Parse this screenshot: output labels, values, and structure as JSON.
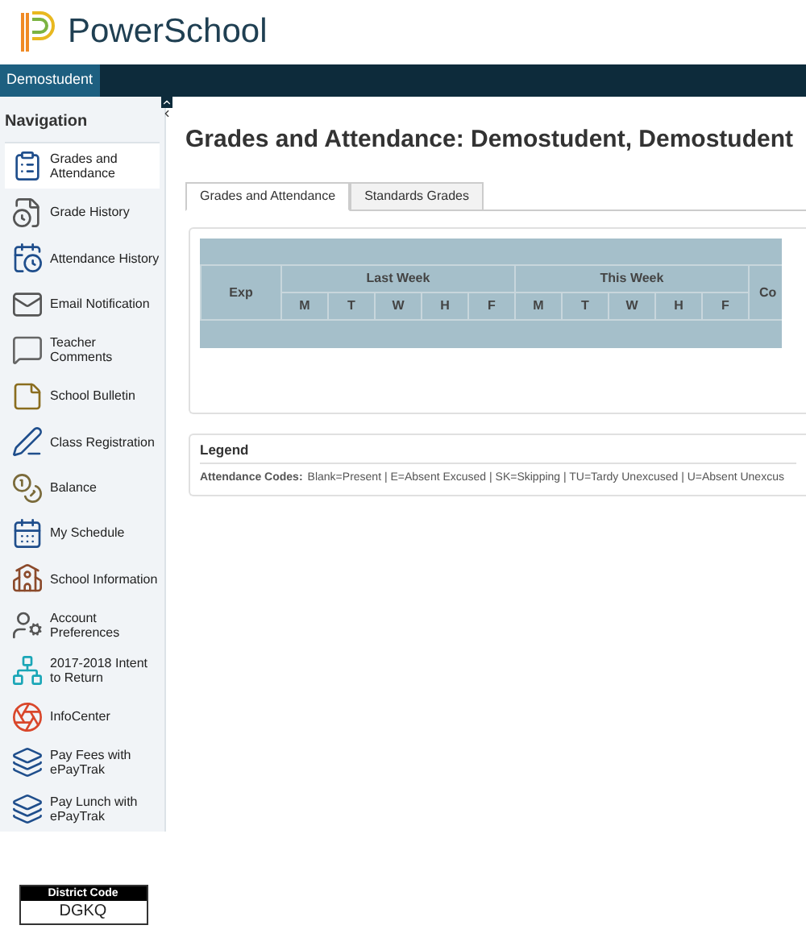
{
  "header": {
    "brand": "PowerSchool"
  },
  "top_bar": {
    "tabs": [
      {
        "label": "Demostudent",
        "selected": true
      }
    ]
  },
  "sidebar": {
    "title": "Navigation",
    "items": [
      {
        "label": "Grades and Attendance",
        "selected": true
      },
      {
        "label": "Grade History",
        "selected": false
      },
      {
        "label": "Attendance History",
        "selected": false
      },
      {
        "label": "Email Notification",
        "selected": false
      },
      {
        "label": "Teacher Comments",
        "selected": false
      },
      {
        "label": "School Bulletin",
        "selected": false
      },
      {
        "label": "Class Registration",
        "selected": false
      },
      {
        "label": "Balance",
        "selected": false
      },
      {
        "label": "My Schedule",
        "selected": false
      },
      {
        "label": "School Information",
        "selected": false
      },
      {
        "label": "Account Preferences",
        "selected": false
      },
      {
        "label": "2017-2018 Intent to Return",
        "selected": false
      },
      {
        "label": "InfoCenter",
        "selected": false
      },
      {
        "label": "Pay Fees with ePayTrak",
        "selected": false
      },
      {
        "label": "Pay Lunch with ePayTrak",
        "selected": false
      }
    ],
    "district_code": {
      "label": "District Code",
      "value": "DGKQ"
    }
  },
  "main": {
    "title": "Grades and Attendance: Demostudent, Demostudent",
    "tabs": [
      {
        "label": "Grades and Attendance",
        "selected": true
      },
      {
        "label": "Standards Grades",
        "selected": false
      }
    ],
    "table": {
      "exp_header": "Exp",
      "weeks": [
        {
          "label": "Last Week",
          "days": [
            "M",
            "T",
            "W",
            "H",
            "F"
          ]
        },
        {
          "label": "This Week",
          "days": [
            "M",
            "T",
            "W",
            "H",
            "F"
          ]
        }
      ],
      "column_4": "Co"
    },
    "legend": {
      "title": "Legend",
      "label": "Attendance Codes:",
      "text": "Blank=Present | E=Absent Excused | SK=Skipping | TU=Tardy Unexcused | U=Absent Unexcus"
    }
  }
}
